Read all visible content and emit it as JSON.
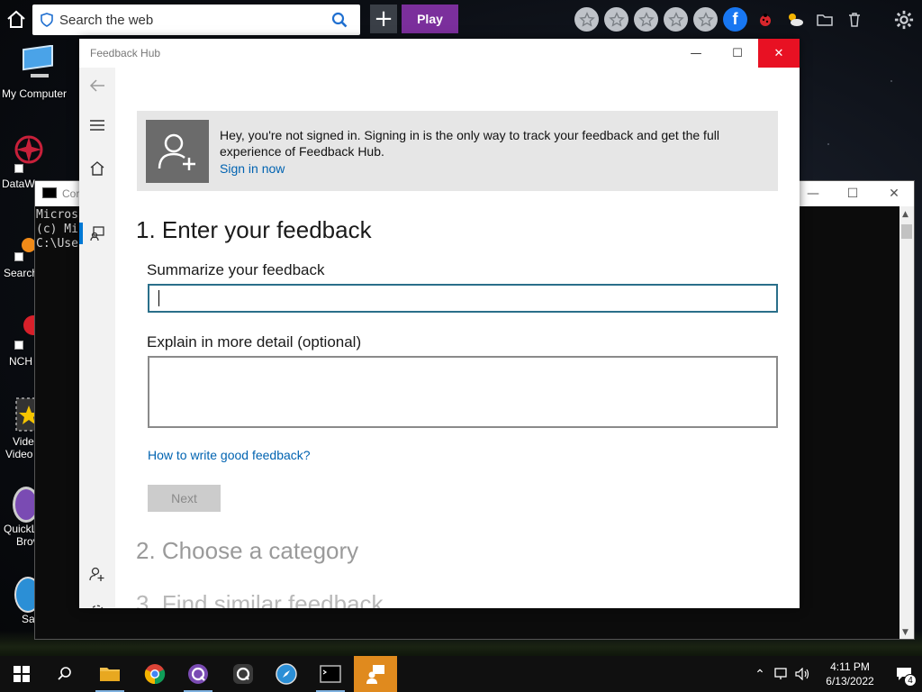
{
  "browser_toolbar": {
    "search_placeholder": "Search the web",
    "play_label": "Play",
    "plus_label": "+"
  },
  "desktop_icons": [
    {
      "label": "My Computer"
    },
    {
      "label": "DataW"
    },
    {
      "label": "Search"
    },
    {
      "label": "NCH"
    },
    {
      "label": "Vide"
    },
    {
      "label": "Video"
    },
    {
      "label": "QuickL"
    },
    {
      "label": "Brov"
    },
    {
      "label": "Saf"
    }
  ],
  "cmd_window": {
    "title": "Cor",
    "lines": [
      "Micros",
      "(c) Mi",
      "",
      "C:\\Use"
    ]
  },
  "feedback_hub": {
    "title": "Feedback Hub",
    "banner": {
      "message": "Hey, you're not signed in. Signing in is the only way to track your feedback and get the full experience of Feedback Hub.",
      "sign_in_link": "Sign in now"
    },
    "step1_heading": "1. Enter your feedback",
    "summary_label": "Summarize your feedback",
    "summary_value": "",
    "detail_label": "Explain in more detail (optional)",
    "detail_value": "",
    "help_link": "How to write good feedback?",
    "next_button": "Next",
    "step2_heading": "2. Choose a category",
    "step3_heading": "3. Find similar feedback"
  },
  "taskbar": {
    "time": "4:11 PM",
    "date": "6/13/2022",
    "notification_count": "4"
  },
  "colors": {
    "accent_blue": "#0078d4",
    "close_red": "#e81123",
    "play_purple": "#7b2f9c",
    "link_blue": "#0063b1",
    "active_task_orange": "#e08a1e"
  }
}
